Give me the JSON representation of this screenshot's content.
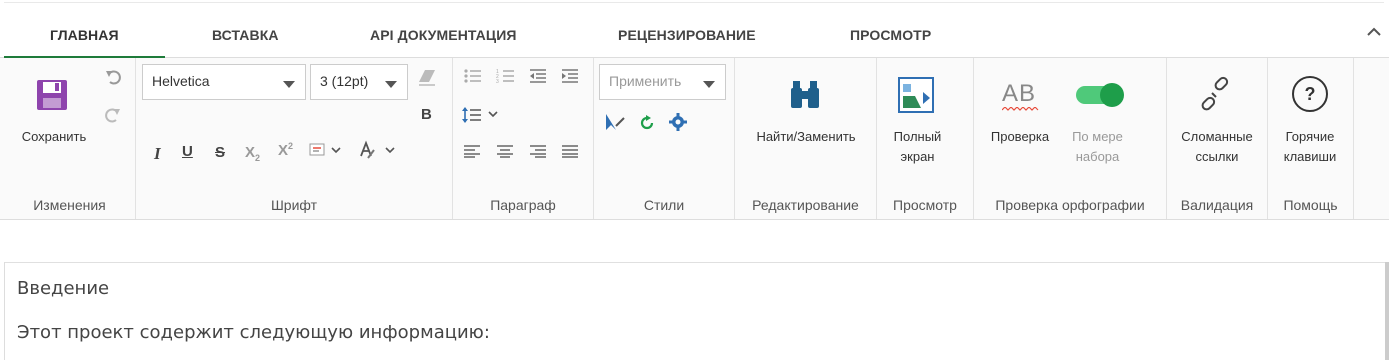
{
  "tabs": [
    {
      "label": "ГЛАВНАЯ",
      "active": true
    },
    {
      "label": "ВСТАВКА"
    },
    {
      "label": "API ДОКУМЕНТАЦИЯ"
    },
    {
      "label": "РЕЦЕНЗИРОВАНИЕ"
    },
    {
      "label": "ПРОСМОТР"
    }
  ],
  "ribbon": {
    "changes": {
      "save_label": "Сохранить",
      "group_label": "Изменения"
    },
    "font": {
      "family_value": "Helvetica",
      "size_value": "3 (12pt)",
      "group_label": "Шрифт",
      "bold": "B",
      "italic": "I",
      "underline": "U",
      "strike": "S"
    },
    "paragraph": {
      "group_label": "Параграф"
    },
    "styles": {
      "apply_placeholder": "Применить",
      "group_label": "Стили"
    },
    "editing": {
      "find_replace_label": "Найти/Заменить",
      "group_label": "Редактирование"
    },
    "view": {
      "fullscreen_label_1": "Полный",
      "fullscreen_label_2": "экран",
      "group_label": "Просмотр"
    },
    "spelling": {
      "check_label": "Проверка",
      "as_you_type_1": "По мере",
      "as_you_type_2": "набора",
      "group_label": "Проверка орфографии",
      "spell_icon_text": "AB"
    },
    "validation": {
      "broken_links_1": "Сломанные",
      "broken_links_2": "ссылки",
      "group_label": "Валидация"
    },
    "help": {
      "hotkeys_1": "Горячие",
      "hotkeys_2": "клавиши",
      "group_label": "Помощь",
      "help_icon_text": "?"
    }
  },
  "document": {
    "paragraphs": [
      "Введение",
      "Этот проект содержит следующую информацию:"
    ]
  },
  "colors": {
    "accent": "#1e7b3a",
    "save_icon": "#8e44ad",
    "binoculars": "#1f5f8b",
    "toggle": "#1e9e4a"
  }
}
